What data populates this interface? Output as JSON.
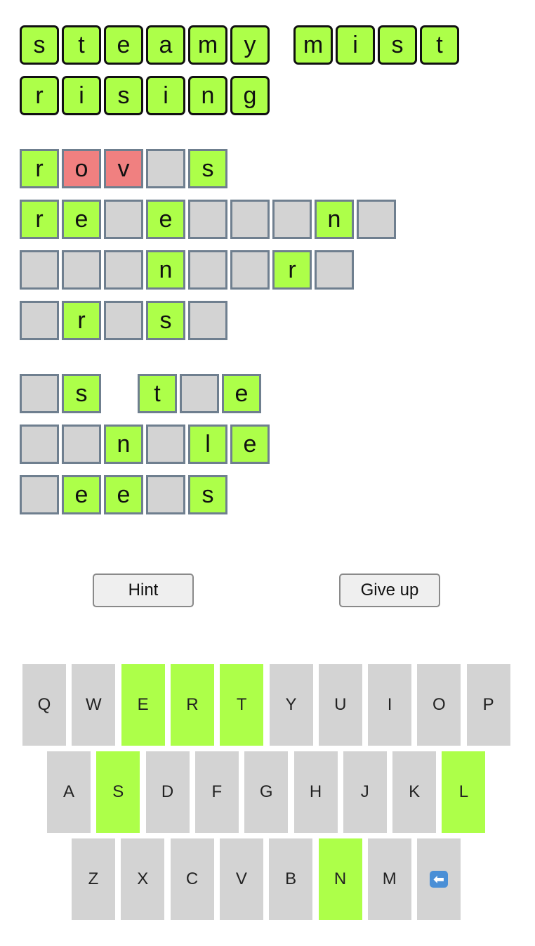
{
  "colors": {
    "correct": "#adff49",
    "wrong": "#f08080",
    "empty": "#d3d3d3",
    "key_default": "#d3d3d3"
  },
  "answer": {
    "rows": [
      [
        [
          "s",
          "t",
          "e",
          "a",
          "m",
          "y"
        ],
        [
          "m",
          "i",
          "s",
          "t"
        ]
      ],
      [
        [
          "r",
          "i",
          "s",
          "i",
          "n",
          "g"
        ]
      ]
    ]
  },
  "guess_groups": [
    [
      [
        [
          {
            "l": "r",
            "s": "correct"
          },
          {
            "l": "o",
            "s": "wrong"
          },
          {
            "l": "v",
            "s": "wrong"
          },
          {
            "l": "",
            "s": "empty"
          },
          {
            "l": "s",
            "s": "correct"
          }
        ]
      ],
      [
        [
          {
            "l": "r",
            "s": "correct"
          },
          {
            "l": "e",
            "s": "correct"
          },
          {
            "l": "",
            "s": "empty"
          },
          {
            "l": "e",
            "s": "correct"
          },
          {
            "l": "",
            "s": "empty"
          },
          {
            "l": "",
            "s": "empty"
          },
          {
            "l": "",
            "s": "empty"
          },
          {
            "l": "n",
            "s": "correct"
          },
          {
            "l": "",
            "s": "empty"
          }
        ]
      ],
      [
        [
          {
            "l": "",
            "s": "empty"
          },
          {
            "l": "",
            "s": "empty"
          },
          {
            "l": "",
            "s": "empty"
          },
          {
            "l": "n",
            "s": "correct"
          },
          {
            "l": "",
            "s": "empty"
          },
          {
            "l": "",
            "s": "empty"
          },
          {
            "l": "r",
            "s": "correct"
          },
          {
            "l": "",
            "s": "empty"
          }
        ]
      ],
      [
        [
          {
            "l": "",
            "s": "empty"
          },
          {
            "l": "r",
            "s": "correct"
          },
          {
            "l": "",
            "s": "empty"
          },
          {
            "l": "s",
            "s": "correct"
          },
          {
            "l": "",
            "s": "empty"
          }
        ]
      ]
    ],
    [
      [
        [
          {
            "l": "",
            "s": "empty"
          },
          {
            "l": "s",
            "s": "correct"
          }
        ],
        [
          {
            "l": "t",
            "s": "correct"
          },
          {
            "l": "",
            "s": "empty"
          },
          {
            "l": "e",
            "s": "correct"
          }
        ]
      ],
      [
        [
          {
            "l": "",
            "s": "empty"
          },
          {
            "l": "",
            "s": "empty"
          },
          {
            "l": "n",
            "s": "correct"
          },
          {
            "l": "",
            "s": "empty"
          },
          {
            "l": "l",
            "s": "correct"
          },
          {
            "l": "e",
            "s": "correct"
          }
        ]
      ],
      [
        [
          {
            "l": "",
            "s": "empty"
          },
          {
            "l": "e",
            "s": "correct"
          },
          {
            "l": "e",
            "s": "correct"
          },
          {
            "l": "",
            "s": "empty"
          },
          {
            "l": "s",
            "s": "correct"
          }
        ]
      ]
    ]
  ],
  "buttons": {
    "hint": "Hint",
    "give_up": "Give up"
  },
  "keyboard": {
    "rows": [
      [
        "Q",
        "W",
        "E",
        "R",
        "T",
        "Y",
        "U",
        "I",
        "O",
        "P"
      ],
      [
        "A",
        "S",
        "D",
        "F",
        "G",
        "H",
        "J",
        "K",
        "L"
      ],
      [
        "Z",
        "X",
        "C",
        "V",
        "B",
        "N",
        "M",
        "backspace"
      ]
    ],
    "highlighted": [
      "E",
      "R",
      "T",
      "S",
      "L",
      "N"
    ],
    "backspace_icon": "left-arrow-icon",
    "backspace_glyph": "⬅"
  }
}
